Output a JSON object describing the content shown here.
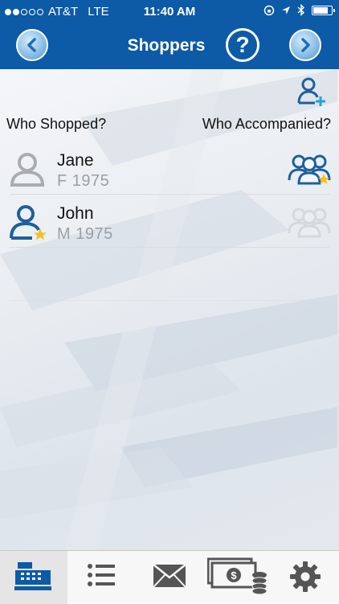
{
  "status_bar": {
    "carrier": "AT&T",
    "network": "LTE",
    "time": "11:40 AM",
    "battery_level": 0.85
  },
  "header": {
    "title": "Shoppers",
    "help_label": "?"
  },
  "columns": {
    "left": "Who Shopped?",
    "right": "Who Accompanied?"
  },
  "shoppers": [
    {
      "name": "Jane",
      "meta": "F  1975",
      "primary": false,
      "accompanied": true
    },
    {
      "name": "John",
      "meta": "M  1975",
      "primary": true,
      "accompanied": false
    }
  ],
  "colors": {
    "brand_blue": "#0d5aa7",
    "icon_blue": "#1d5f9c",
    "star": "#f5c021",
    "inactive_gray": "#a9adb2"
  },
  "tabs": [
    "register-icon",
    "list-icon",
    "mail-icon",
    "money-icon",
    "gear-icon"
  ]
}
